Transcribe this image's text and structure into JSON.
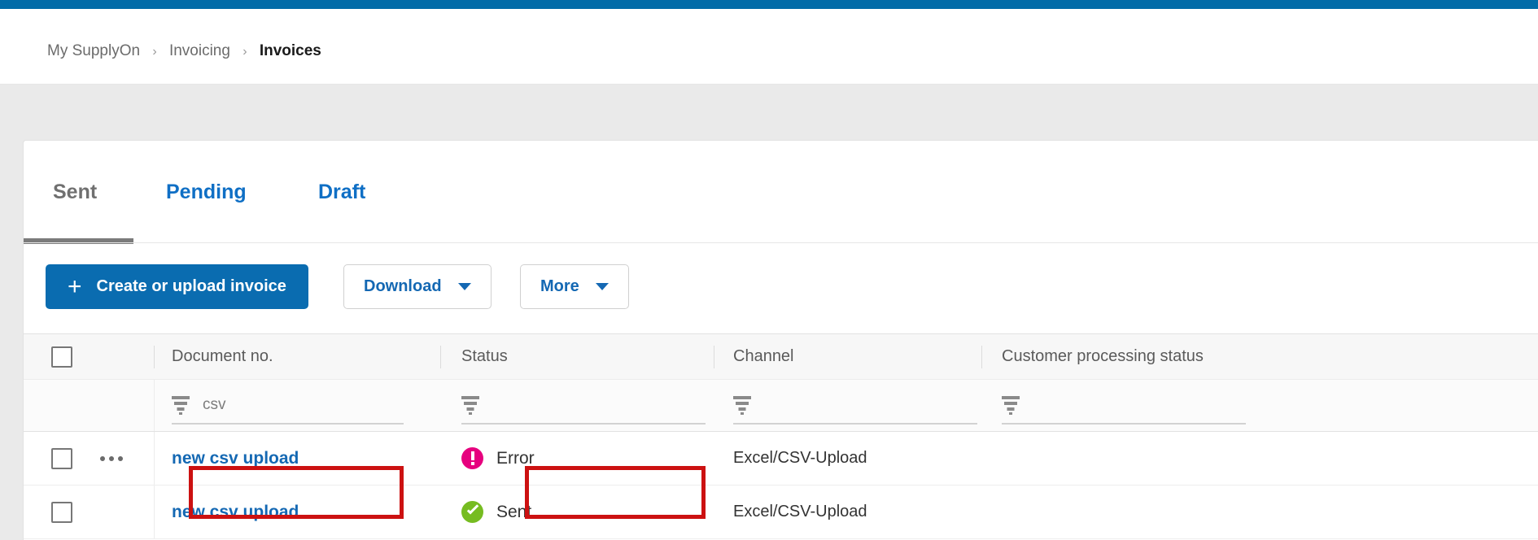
{
  "theme": {
    "top_bar_color": "#036ca8",
    "primary_button_color": "#0a6cb0",
    "link_color": "#1468b3",
    "error_color": "#e6007e",
    "sent_color": "#76bc21",
    "annotation_color": "#cc1111"
  },
  "breadcrumb": {
    "items": [
      {
        "label": "My SupplyOn",
        "current": false
      },
      {
        "label": "Invoicing",
        "current": false
      },
      {
        "label": "Invoices",
        "current": true
      }
    ],
    "separator": "›"
  },
  "tabs": [
    {
      "label": "Sent",
      "active": true
    },
    {
      "label": "Pending",
      "active": false
    },
    {
      "label": "Draft",
      "active": false
    }
  ],
  "toolbar": {
    "create_label": "Create or upload invoice",
    "create_icon": "plus-icon",
    "download_label": "Download",
    "more_label": "More",
    "caret_icon": "chevron-down-icon"
  },
  "table": {
    "columns": [
      {
        "key": "select",
        "label": ""
      },
      {
        "key": "document",
        "label": "Document no."
      },
      {
        "key": "status",
        "label": "Status"
      },
      {
        "key": "channel",
        "label": "Channel"
      },
      {
        "key": "customer",
        "label": "Customer processing status"
      }
    ],
    "filters": [
      {
        "column": "document",
        "icon": "filter-icon",
        "value": "csv",
        "placeholder": ""
      },
      {
        "column": "status",
        "icon": "filter-icon",
        "value": "",
        "placeholder": ""
      },
      {
        "column": "channel",
        "icon": "filter-icon",
        "value": "",
        "placeholder": ""
      },
      {
        "column": "customer",
        "icon": "filter-icon",
        "value": "",
        "placeholder": ""
      }
    ],
    "rows": [
      {
        "selected": false,
        "menu_icon": "kebab-menu-icon",
        "document": "new csv upload",
        "status": {
          "label": "Error",
          "icon": "error-icon",
          "kind": "error"
        },
        "channel": "Excel/CSV-Upload",
        "customer": ""
      },
      {
        "selected": false,
        "menu_icon": "",
        "document": "new csv upload",
        "status": {
          "label": "Sent",
          "icon": "success-icon",
          "kind": "sent"
        },
        "channel": "Excel/CSV-Upload",
        "customer": ""
      }
    ]
  },
  "annotations": [
    {
      "name": "document-no-highlight",
      "target": "new csv upload"
    },
    {
      "name": "status-error-highlight",
      "target": "Error"
    }
  ]
}
